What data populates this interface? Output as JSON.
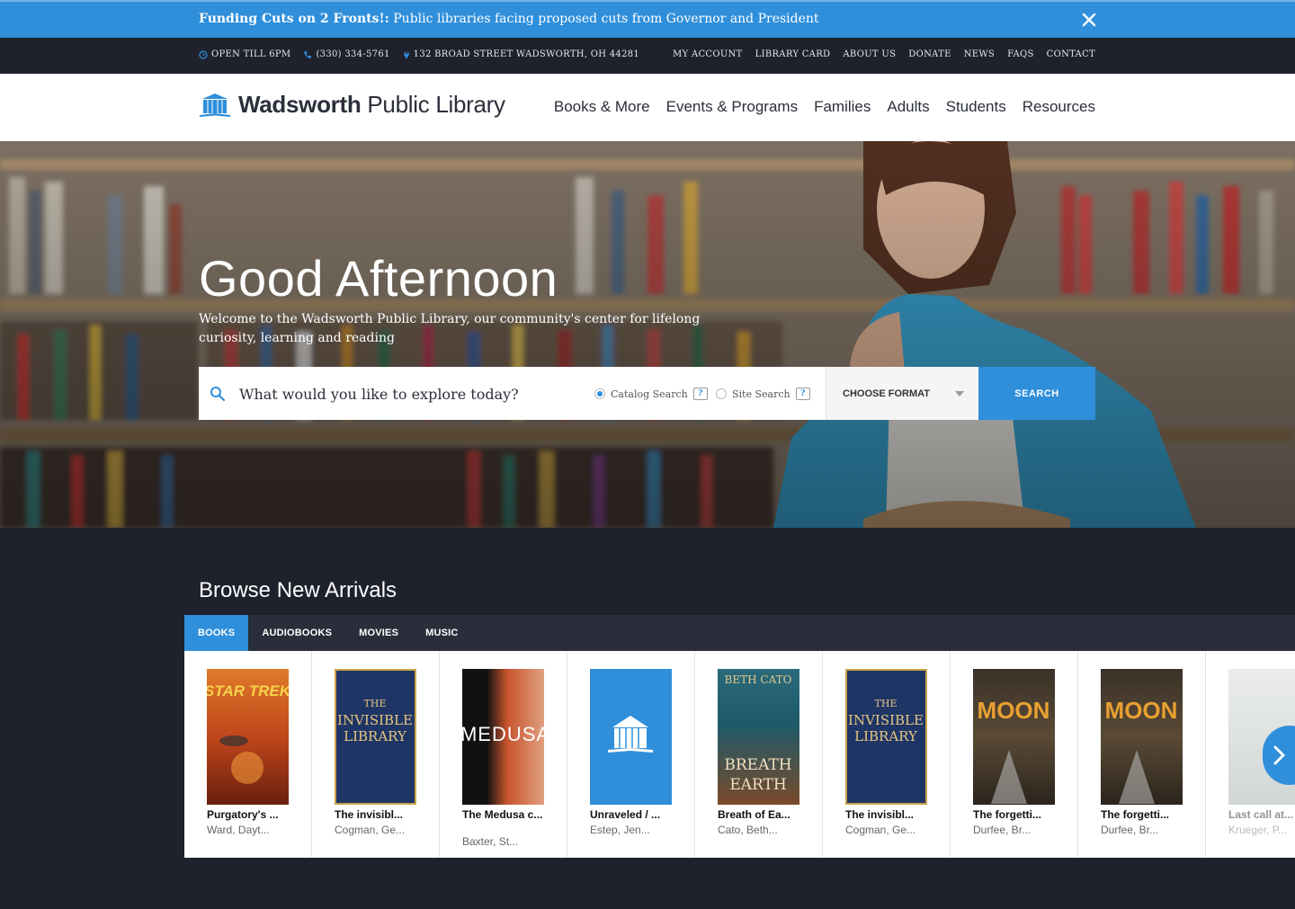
{
  "alert": {
    "title": "Funding Cuts on 2 Fronts!:",
    "message": " Public libraries facing proposed cuts from Governor and President"
  },
  "utility": {
    "hours": "OPEN TILL 6PM",
    "phone": "(330) 334-5761",
    "address": "132 BROAD STREET WADSWORTH, OH 44281",
    "links": [
      "MY ACCOUNT",
      "LIBRARY CARD",
      "ABOUT US",
      "DONATE",
      "NEWS",
      "FAQS",
      "CONTACT"
    ]
  },
  "header": {
    "logo_bold": "Wadsworth",
    "logo_rest": " Public Library",
    "nav": [
      "Books & More",
      "Events & Programs",
      "Families",
      "Adults",
      "Students",
      "Resources"
    ]
  },
  "hero": {
    "greeting": "Good Afternoon",
    "subtitle": "Welcome to the Wadsworth Public Library, our community's center for lifelong curiosity, learning and reading"
  },
  "search": {
    "placeholder": "What would you like to explore today?",
    "option_catalog": "Catalog Search",
    "option_site": "Site Search",
    "help": "?",
    "format_label": "CHOOSE FORMAT",
    "button_label": "SEARCH"
  },
  "browse": {
    "title": "Browse New Arrivals",
    "tabs": [
      "BOOKS",
      "AUDIOBOOKS",
      "MOVIES",
      "MUSIC"
    ],
    "books": [
      {
        "title": "Purgatory's ...",
        "author": "Ward, Dayt...",
        "cover_color": "#c0461b"
      },
      {
        "title": "The invisibl...",
        "author": "Cogman, Ge...",
        "cover_color": "#1f3566"
      },
      {
        "title": "The Medusa c...",
        "author": "Baxter, St...",
        "cover_color": "#7a2a1c"
      },
      {
        "title": "Unraveled / ...",
        "author": "Estep, Jen...",
        "cover_color": "#2f8fdb"
      },
      {
        "title": "Breath of Ea...",
        "author": "Cato, Beth...",
        "cover_color": "#1d5a6a"
      },
      {
        "title": "The invisibl...",
        "author": "Cogman, Ge...",
        "cover_color": "#1f3566"
      },
      {
        "title": "The forgetti...",
        "author": "Durfee, Br...",
        "cover_color": "#5a4a36"
      },
      {
        "title": "The forgetti...",
        "author": "Durfee, Br...",
        "cover_color": "#5a4a36"
      },
      {
        "title": "Last call at...",
        "author": "Krueger, P...",
        "cover_color": "#b9c2c0"
      }
    ]
  },
  "colors": {
    "accent": "#2f8fdb",
    "dark": "#1f222d"
  },
  "icons": [
    "close-icon",
    "clock-icon",
    "phone-icon",
    "map-pin-icon",
    "library-logo-icon",
    "search-icon",
    "chevron-right-icon"
  ]
}
